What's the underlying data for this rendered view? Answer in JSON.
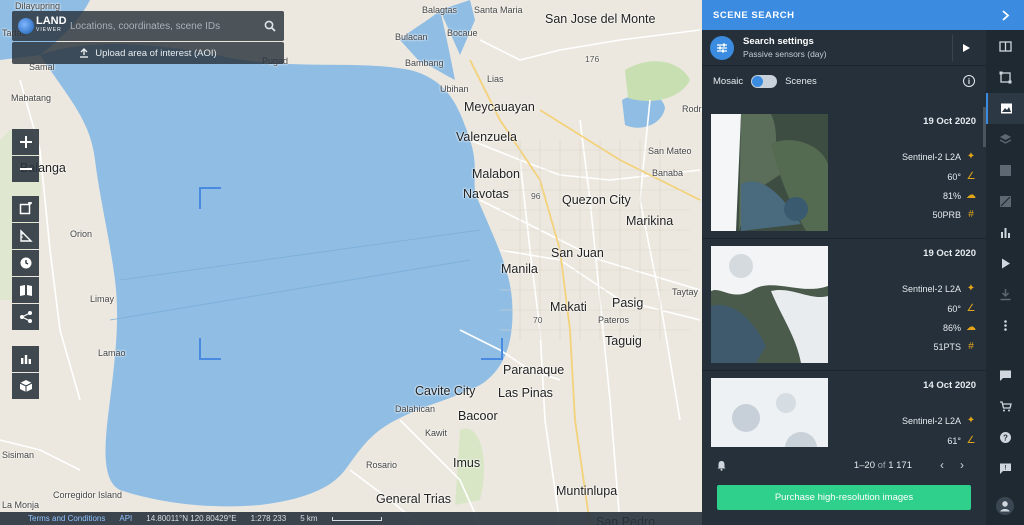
{
  "search": {
    "placeholder": "Locations, coordinates, scene IDs",
    "logo_line1": "LAND",
    "logo_line2": "VIEWER"
  },
  "upload": {
    "label": "Upload area of interest (AOI)"
  },
  "map": {
    "water_color": "#8fbde4",
    "land_color": "#ece8df",
    "places": [
      {
        "name": "Dilayupring",
        "size": "small"
      },
      {
        "name": "Balagtas",
        "size": "small"
      },
      {
        "name": "Santa Maria",
        "size": "small"
      },
      {
        "name": "San Jose del Monte",
        "size": "big"
      },
      {
        "name": "Tarlac",
        "size": "small"
      },
      {
        "name": "Bulacan",
        "size": "small"
      },
      {
        "name": "Bocaue",
        "size": "small"
      },
      {
        "name": "Samal",
        "size": "small"
      },
      {
        "name": "Pugad",
        "size": "small"
      },
      {
        "name": "Bambang",
        "size": "small"
      },
      {
        "name": "176",
        "size": "tiny"
      },
      {
        "name": "Lias",
        "size": "small"
      },
      {
        "name": "Mabatang",
        "size": "small"
      },
      {
        "name": "Ubihan",
        "size": "small"
      },
      {
        "name": "Meycauayan",
        "size": "big"
      },
      {
        "name": "Valenzuela",
        "size": "big"
      },
      {
        "name": "Balanga",
        "size": "big"
      },
      {
        "name": "Malabon",
        "size": "big"
      },
      {
        "name": "San Mateo",
        "size": "small"
      },
      {
        "name": "Banaba",
        "size": "small"
      },
      {
        "name": "Navotas",
        "size": "big"
      },
      {
        "name": "96",
        "size": "tiny"
      },
      {
        "name": "Quezon City",
        "size": "big"
      },
      {
        "name": "Marikina",
        "size": "big"
      },
      {
        "name": "Orion",
        "size": "small"
      },
      {
        "name": "San Juan",
        "size": "big"
      },
      {
        "name": "Manila",
        "size": "big"
      },
      {
        "name": "Limay",
        "size": "small"
      },
      {
        "name": "Taytay",
        "size": "small"
      },
      {
        "name": "Makati",
        "size": "big"
      },
      {
        "name": "Pasig",
        "size": "big"
      },
      {
        "name": "70",
        "size": "tiny"
      },
      {
        "name": "Pateros",
        "size": "small"
      },
      {
        "name": "Lamao",
        "size": "small"
      },
      {
        "name": "Taguig",
        "size": "big"
      },
      {
        "name": "Paranaque",
        "size": "big"
      },
      {
        "name": "Cavite City",
        "size": "big"
      },
      {
        "name": "Las Pinas",
        "size": "big"
      },
      {
        "name": "Dalahican",
        "size": "small"
      },
      {
        "name": "Bacoor",
        "size": "big"
      },
      {
        "name": "Kawit",
        "size": "small"
      },
      {
        "name": "Sisiman",
        "size": "small"
      },
      {
        "name": "Imus",
        "size": "big"
      },
      {
        "name": "Rosario",
        "size": "small"
      },
      {
        "name": "Corregidor Island",
        "size": "small"
      },
      {
        "name": "Muntinlupa",
        "size": "big"
      },
      {
        "name": "General Trias",
        "size": "big"
      },
      {
        "name": "La Monja",
        "size": "small"
      },
      {
        "name": "San Pedro",
        "size": "big"
      },
      {
        "name": "Rodri",
        "size": "small"
      }
    ]
  },
  "tools": [
    {
      "name": "zoom-in",
      "icon": "plus"
    },
    {
      "name": "zoom-out",
      "icon": "minus"
    },
    {
      "name": "draw-aoi",
      "icon": "square-edit"
    },
    {
      "name": "measure",
      "icon": "ruler"
    },
    {
      "name": "time-info",
      "icon": "clock"
    },
    {
      "name": "map-layers",
      "icon": "book"
    },
    {
      "name": "share",
      "icon": "share"
    },
    {
      "name": "analytics",
      "icon": "bar-chart"
    },
    {
      "name": "3d-view",
      "icon": "cube"
    }
  ],
  "statusbar": {
    "terms": "Terms and Conditions",
    "api": "API",
    "coords": "14.80011°N 120.80429°E",
    "scale": "1:278 233",
    "scale_label": "5 km"
  },
  "panel": {
    "title": "SCENE SEARCH",
    "settings_title": "Search settings",
    "settings_sub": "Passive sensors (day)",
    "mosaic_label": "Mosaic",
    "scenes_label": "Scenes",
    "scenes": [
      {
        "date": "19 Oct 2020",
        "sensor": "Sentinel-2  L2A",
        "angle": "60°",
        "cloud": "81%",
        "tile": "50PRB"
      },
      {
        "date": "19 Oct 2020",
        "sensor": "Sentinel-2  L2A",
        "angle": "60°",
        "cloud": "86%",
        "tile": "51PTS"
      },
      {
        "date": "14 Oct 2020",
        "sensor": "Sentinel-2  L2A",
        "angle": "61°",
        "cloud": "",
        "tile": ""
      }
    ],
    "pager_range": "1–20",
    "pager_of": "of",
    "pager_total": "1 171",
    "purchase_label": "Purchase high-resolution images",
    "accent": "#3b8ce0",
    "purchase_color": "#2fcf8c"
  },
  "rail": [
    {
      "name": "compare",
      "icon": "compare"
    },
    {
      "name": "aoi",
      "icon": "aoi"
    },
    {
      "name": "scene-search",
      "icon": "image",
      "active": true
    },
    {
      "name": "layers",
      "icon": "layers"
    },
    {
      "name": "band-combination",
      "icon": "bands"
    },
    {
      "name": "indices",
      "icon": "indices"
    },
    {
      "name": "statistics",
      "icon": "bar-chart"
    },
    {
      "name": "timelapse",
      "icon": "play"
    },
    {
      "name": "download",
      "icon": "download"
    },
    {
      "name": "more",
      "icon": "more-vert"
    },
    {
      "name": "comments",
      "icon": "comment"
    },
    {
      "name": "cart",
      "icon": "cart"
    },
    {
      "name": "help",
      "icon": "help"
    },
    {
      "name": "feedback",
      "icon": "chat"
    },
    {
      "name": "account",
      "icon": "user"
    }
  ]
}
